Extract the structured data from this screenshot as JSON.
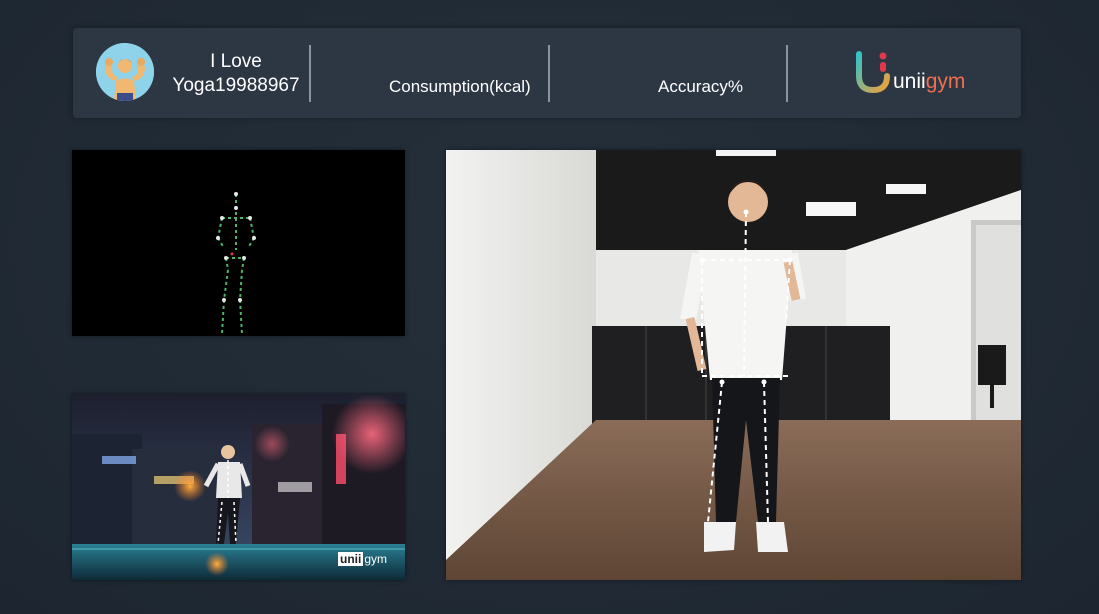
{
  "header": {
    "avatar_icon": "muscle-man-avatar-icon",
    "user_name_line1": "I Love",
    "user_name_line2": "Yoga19988967",
    "consumption_label": "Consumption(kcal)",
    "accuracy_label": "Accuracy%",
    "brand": {
      "logo_icon": "uniigym-logo-icon",
      "name_prefix": "unii",
      "name_suffix": "gym"
    }
  },
  "panels": {
    "skeleton": {
      "icon": "skeleton-tracking-figure"
    },
    "game": {
      "logo_box": "unii",
      "logo_suffix": "gym"
    },
    "camera": {
      "icon": "live-camera-feed"
    }
  },
  "colors": {
    "background": "#222b35",
    "header_bg": "#2d3744",
    "skeleton_green": "#4fb56a",
    "brand_teal": "#37c1c4",
    "brand_orange": "#ef6f50",
    "brand_red": "#e0384a"
  }
}
